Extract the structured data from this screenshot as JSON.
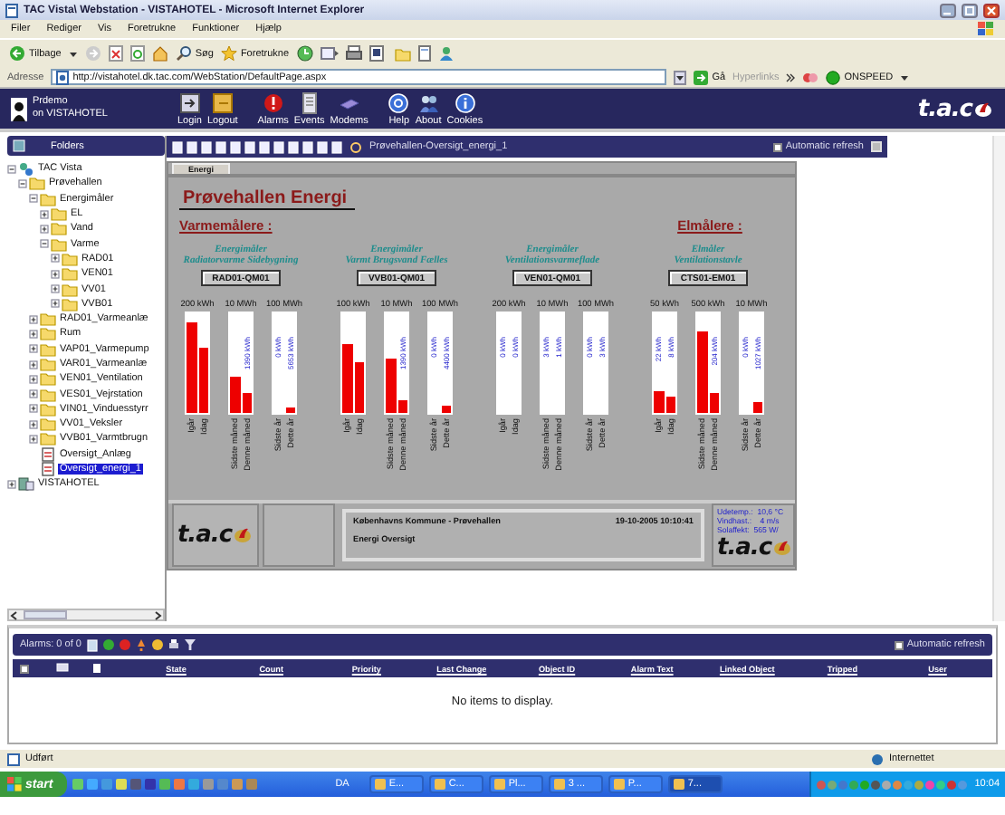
{
  "window": {
    "title": "TAC Vista\\ Webstation - VISTAHOTEL - Microsoft Internet Explorer"
  },
  "menu": [
    "Filer",
    "Rediger",
    "Vis",
    "Foretrukne",
    "Funktioner",
    "Hjælp"
  ],
  "toolbar": [
    {
      "kind": "back",
      "label": "Tilbage"
    },
    {
      "kind": "search",
      "label": "Søg"
    },
    {
      "kind": "favorites",
      "label": "Foretrukne"
    }
  ],
  "address": {
    "label": "Adresse",
    "value": "http://vistahotel.dk.tac.com/WebStation/DefaultPage.aspx",
    "go": "Gå",
    "links": "Hyperlinks",
    "addon": "ONSPEED"
  },
  "app_header": {
    "user": "Prdemo",
    "server": "on VISTAHOTEL",
    "logo": "t.a.c",
    "buttons": [
      {
        "kind": "login",
        "label": "Login"
      },
      {
        "kind": "logout",
        "label": "Logout"
      },
      {
        "kind": "alarms",
        "label": "Alarms"
      },
      {
        "kind": "events",
        "label": "Events"
      },
      {
        "kind": "modems",
        "label": "Modems"
      },
      {
        "kind": "help",
        "label": "Help"
      },
      {
        "kind": "about",
        "label": "About"
      },
      {
        "kind": "cookies",
        "label": "Cookies"
      }
    ]
  },
  "folders": {
    "title": "Folders",
    "tree": [
      {
        "label": "TAC Vista",
        "kind": "root",
        "expanded": true,
        "selected": false,
        "children": [
          {
            "label": "Prøvehallen",
            "kind": "folder",
            "expanded": true,
            "selected": false,
            "children": [
              {
                "label": "Energimåler",
                "kind": "folder",
                "expanded": true,
                "selected": false,
                "children": [
                  {
                    "label": "EL",
                    "kind": "folder",
                    "expanded": false,
                    "selected": false
                  },
                  {
                    "label": "Vand",
                    "kind": "folder",
                    "expanded": false,
                    "selected": false
                  },
                  {
                    "label": "Varme",
                    "kind": "folder",
                    "expanded": true,
                    "selected": false,
                    "children": [
                      {
                        "label": "RAD01",
                        "kind": "folder",
                        "expanded": false,
                        "selected": false
                      },
                      {
                        "label": "VEN01",
                        "kind": "folder",
                        "expanded": false,
                        "selected": false
                      },
                      {
                        "label": "VV01",
                        "kind": "folder",
                        "expanded": false,
                        "selected": false
                      },
                      {
                        "label": "VVB01",
                        "kind": "folder",
                        "expanded": false,
                        "selected": false
                      }
                    ]
                  }
                ]
              },
              {
                "label": "RAD01_Varmeanlæ",
                "kind": "folder",
                "expanded": false,
                "selected": false
              },
              {
                "label": "Rum",
                "kind": "folder",
                "expanded": false,
                "selected": false
              },
              {
                "label": "VAP01_Varmepump",
                "kind": "folder",
                "expanded": false,
                "selected": false
              },
              {
                "label": "VAR01_Varmeanlæ",
                "kind": "folder",
                "expanded": false,
                "selected": false
              },
              {
                "label": "VEN01_Ventilation",
                "kind": "folder",
                "expanded": false,
                "selected": false
              },
              {
                "label": "VES01_Vejrstation",
                "kind": "folder",
                "expanded": false,
                "selected": false
              },
              {
                "label": "VIN01_Vinduesstyrr",
                "kind": "folder",
                "expanded": false,
                "selected": false
              },
              {
                "label": "VV01_Veksler",
                "kind": "folder",
                "expanded": false,
                "selected": false
              },
              {
                "label": "VVB01_Varmtbrugn",
                "kind": "folder",
                "expanded": false,
                "selected": false
              },
              {
                "label": "Oversigt_Anlæg",
                "kind": "page",
                "selected": false
              },
              {
                "label": "Oversigt_energi_1",
                "kind": "page",
                "selected": true
              }
            ]
          }
        ]
      },
      {
        "label": "VISTAHOTEL",
        "kind": "server",
        "expanded": false,
        "selected": false
      }
    ]
  },
  "content": {
    "breadcrumb": "Prøvehallen-Oversigt_energi_1",
    "auto_refresh": {
      "label": "Automatic refresh",
      "checked": false
    },
    "tabs": [
      {
        "label": "Energi",
        "selected": true
      }
    ],
    "heading": "Prøvehallen Energi",
    "sections": [
      {
        "title": "Varmemålere :",
        "meters": [
          {
            "line1": "Energimåler",
            "line2": "Radiatorvarme Sidebygning",
            "button": "RAD01-QM01",
            "columns": [
              {
                "scale": "200 kWh",
                "bars": [
                  {
                    "label": "Igår",
                    "level": 0.9
                  },
                  {
                    "label": "Idag",
                    "level": 0.64
                  }
                ]
              },
              {
                "scale": "10 MWh",
                "bars": [
                  {
                    "label": "Sidste måned",
                    "level": 0.36
                  },
                  {
                    "label": "Denne måned",
                    "level": 0.2,
                    "reading": "1390 kWh"
                  }
                ]
              },
              {
                "scale": "100 MWh",
                "bars": [
                  {
                    "label": "Sidste år",
                    "level": 0,
                    "reading": "0 kWh"
                  },
                  {
                    "label": "Dette år",
                    "level": 0.06,
                    "reading": "5653 kWh"
                  }
                ]
              }
            ]
          },
          {
            "line1": "Energimåler",
            "line2": "Varmt Brugsvand Fælles",
            "button": "VVB01-QM01",
            "columns": [
              {
                "scale": "100 kWh",
                "bars": [
                  {
                    "label": "Igår",
                    "level": 0.68
                  },
                  {
                    "label": "Idag",
                    "level": 0.5
                  }
                ]
              },
              {
                "scale": "10 MWh",
                "bars": [
                  {
                    "label": "Sidste måned",
                    "level": 0.53
                  },
                  {
                    "label": "Denne måned",
                    "level": 0.12,
                    "reading": "1390 kWh"
                  }
                ]
              },
              {
                "scale": "100 MWh",
                "bars": [
                  {
                    "label": "Sidste år",
                    "level": 0,
                    "reading": "0 kWh"
                  },
                  {
                    "label": "Dette år",
                    "level": 0.07,
                    "reading": "4400 kWh"
                  }
                ]
              }
            ]
          },
          {
            "line1": "Energimåler",
            "line2": "Ventilationsvarmeflade",
            "button": "VEN01-QM01",
            "columns": [
              {
                "scale": "200 kWh",
                "bars": [
                  {
                    "label": "Igår",
                    "level": 0,
                    "reading": "0 kWh"
                  },
                  {
                    "label": "Idag",
                    "level": 0,
                    "reading": "0 kWh"
                  }
                ]
              },
              {
                "scale": "10 MWh",
                "bars": [
                  {
                    "label": "Sidste måned",
                    "level": 0,
                    "reading": "3 kWh"
                  },
                  {
                    "label": "Denne måned",
                    "level": 0,
                    "reading": "1 kWh"
                  }
                ]
              },
              {
                "scale": "100 MWh",
                "bars": [
                  {
                    "label": "Sidste år",
                    "level": 0,
                    "reading": "0 kWh"
                  },
                  {
                    "label": "Dette år",
                    "level": 0,
                    "reading": "3 kWh"
                  }
                ]
              }
            ]
          }
        ]
      },
      {
        "title": "Elmålere :",
        "meters": [
          {
            "line1": "Elmåler",
            "line2": "Ventilationstavle",
            "button": "CTS01-EM01",
            "columns": [
              {
                "scale": "50 kWh",
                "bars": [
                  {
                    "label": "Igår",
                    "level": 0.22,
                    "reading": "22 kWh"
                  },
                  {
                    "label": "Idag",
                    "level": 0.16,
                    "reading": "8 kWh"
                  }
                ]
              },
              {
                "scale": "500 kWh",
                "bars": [
                  {
                    "label": "Sidste måned",
                    "level": 0.8
                  },
                  {
                    "label": "Denne måned",
                    "level": 0.2,
                    "reading": "204 kWh"
                  }
                ]
              },
              {
                "scale": "10 MWh",
                "bars": [
                  {
                    "label": "Sidste år",
                    "level": 0,
                    "reading": "0 kWh"
                  },
                  {
                    "label": "Dette år",
                    "level": 0.1,
                    "reading": "1027 kWh"
                  }
                ]
              }
            ]
          }
        ]
      }
    ],
    "footer": {
      "logo": "t.a.c",
      "site": "Københavns Kommune - Prøvehallen",
      "timestamp": "19-10-2005 10:10:41",
      "page": "Energi Oversigt",
      "weather": [
        "Udetemp.:  10,6 °C",
        "Vindhast.:    4 m/s",
        "Solaffekt:  565 W/"
      ],
      "logo2": "t.a.c"
    }
  },
  "alarms": {
    "summary": "Alarms: 0 of 0",
    "select_all": {
      "checked": false
    },
    "auto_refresh": {
      "label": "Automatic refresh",
      "checked": false
    },
    "columns": [
      "State",
      "Count",
      "Priority",
      "Last Change",
      "Object ID",
      "Alarm Text",
      "Linked Object",
      "Tripped",
      "User"
    ],
    "empty": "No items to display."
  },
  "status_bar": {
    "text": "Udført",
    "zone": "Internettet"
  },
  "taskbar": {
    "start": "start",
    "language": "DA",
    "tasks": [
      {
        "label": "E...",
        "selected": false
      },
      {
        "label": "C...",
        "selected": false
      },
      {
        "label": "Pl...",
        "selected": false
      },
      {
        "label": "3 ...",
        "selected": false
      },
      {
        "label": "P...",
        "selected": false
      },
      {
        "label": "7...",
        "selected": true
      }
    ],
    "clock": "10:04"
  }
}
